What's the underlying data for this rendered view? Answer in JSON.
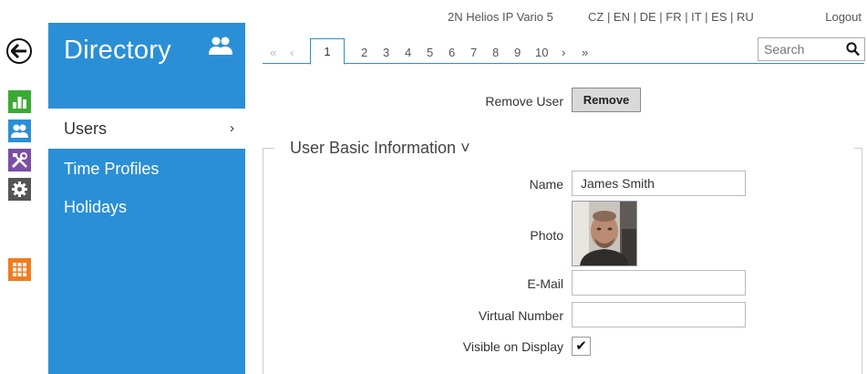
{
  "header": {
    "device": "2N Helios IP Vario 5",
    "languages": "CZ | EN | DE | FR | IT | ES | RU",
    "logout": "Logout"
  },
  "sidebar": {
    "title": "Directory",
    "items": [
      {
        "label": "Users",
        "active": true,
        "chevron": "›"
      },
      {
        "label": "Time Profiles"
      },
      {
        "label": "Holidays"
      }
    ]
  },
  "rail": {
    "icons": [
      "back-icon",
      "status-chart-icon",
      "directory-users-icon",
      "hardware-tools-icon",
      "settings-gear-icon",
      "services-grid-icon"
    ],
    "colors": {
      "status": "#3aaa35",
      "directory": "#2a8fd6",
      "hardware": "#7b4fa3",
      "settings": "#555555",
      "services": "#f07c1f"
    }
  },
  "pager": {
    "first": "«",
    "prev": "‹",
    "pages": [
      "1",
      "2",
      "3",
      "4",
      "5",
      "6",
      "7",
      "8",
      "9",
      "10"
    ],
    "current": "1",
    "next": "›",
    "last": "»"
  },
  "search": {
    "placeholder": "Search"
  },
  "remove": {
    "label": "Remove User",
    "button": "Remove"
  },
  "section": {
    "title": "User Basic Information ˅"
  },
  "form": {
    "name_label": "Name",
    "name_value": "James Smith",
    "photo_label": "Photo",
    "email_label": "E-Mail",
    "email_value": "",
    "virtual_label": "Virtual Number",
    "virtual_value": "",
    "visible_label": "Visible on Display",
    "visible_checked": true,
    "check_glyph": "✔"
  }
}
